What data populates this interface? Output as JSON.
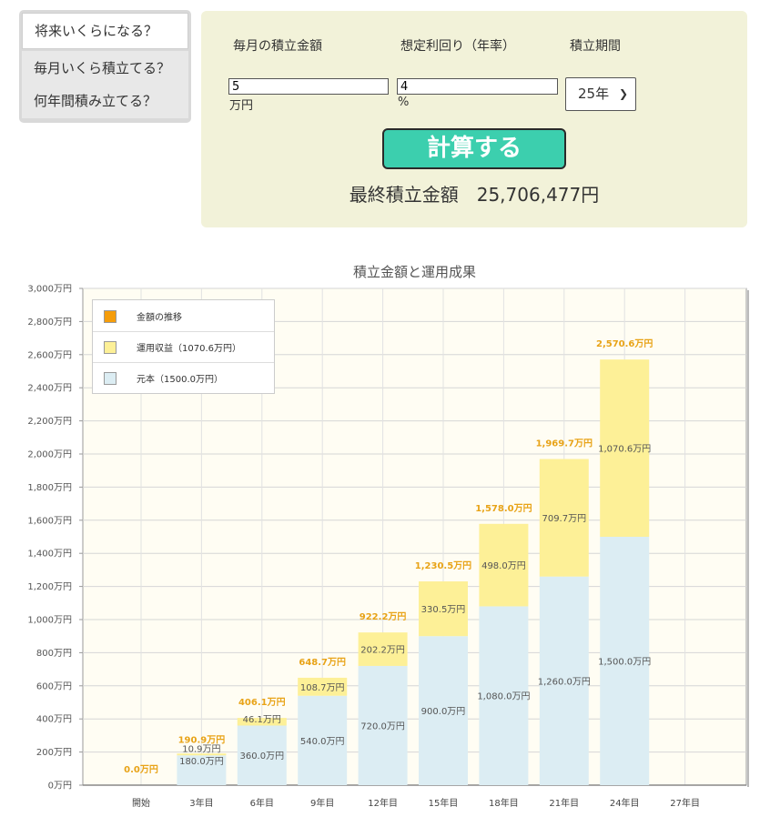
{
  "tabs": [
    {
      "label": "将来いくらになる？",
      "active": true
    },
    {
      "label": "毎月いくら積立てる？",
      "active": false
    },
    {
      "label": "何年間積み立てる？",
      "active": false
    }
  ],
  "form": {
    "monthly_label": "毎月の積立金額",
    "monthly_value": "5",
    "monthly_unit": "万円",
    "rate_label": "想定利回り（年率）",
    "rate_value": "4",
    "rate_unit": "%",
    "period_label": "積立期間",
    "period_selected": "25年",
    "calc_button": "計算する",
    "result_label": "最終積立金額",
    "result_value": "25,706,477円"
  },
  "colors": {
    "accent": "#3ccfae",
    "panel_bg": "#f2f2d9",
    "principal": "#dcedf3",
    "gain": "#fdf097",
    "trend": "#f59d0b",
    "total_label": "#e8a317",
    "plot_bg": "#fffdf3"
  },
  "chart_data": {
    "type": "bar",
    "stacked": true,
    "title": "積立金額と運用成果",
    "categories": [
      "開始",
      "3年目",
      "6年目",
      "9年目",
      "12年目",
      "15年目",
      "18年目",
      "21年目",
      "24年目",
      "27年目"
    ],
    "series": [
      {
        "name": "元本（1500.0万円）",
        "values": [
          0,
          180.0,
          360.0,
          540.0,
          720.0,
          900.0,
          1080.0,
          1260.0,
          1500.0,
          null
        ]
      },
      {
        "name": "運用収益（1070.6万円）",
        "values": [
          0,
          10.9,
          46.1,
          108.7,
          202.2,
          330.5,
          498.0,
          709.7,
          1070.6,
          null
        ]
      },
      {
        "name": "金額の推移",
        "values": [
          0.0,
          190.9,
          406.1,
          648.7,
          922.2,
          1230.5,
          1578.0,
          1969.7,
          2570.6,
          null
        ]
      }
    ],
    "bar_labels_principal": [
      "",
      "180.0万円",
      "360.0万円",
      "540.0万円",
      "720.0万円",
      "900.0万円",
      "1,080.0万円",
      "1,260.0万円",
      "1,500.0万円",
      ""
    ],
    "bar_labels_gain": [
      "",
      "10.9万円",
      "46.1万円",
      "108.7万円",
      "202.2万円",
      "330.5万円",
      "498.0万円",
      "709.7万円",
      "1,070.6万円",
      ""
    ],
    "bar_labels_total": [
      "0.0万円",
      "190.9万円",
      "406.1万円",
      "648.7万円",
      "922.2万円",
      "1,230.5万円",
      "1,578.0万円",
      "1,969.7万円",
      "2,570.6万円",
      ""
    ],
    "y_ticks": [
      "0万円",
      "200万円",
      "400万円",
      "600万円",
      "800万円",
      "1,000万円",
      "1,200万円",
      "1,400万円",
      "1,600万円",
      "1,800万円",
      "2,000万円",
      "2,200万円",
      "2,400万円",
      "2,600万円",
      "2,800万円",
      "3,000万円"
    ],
    "ylim": [
      0,
      3000
    ],
    "legend_position": "top-left",
    "grid": true
  }
}
